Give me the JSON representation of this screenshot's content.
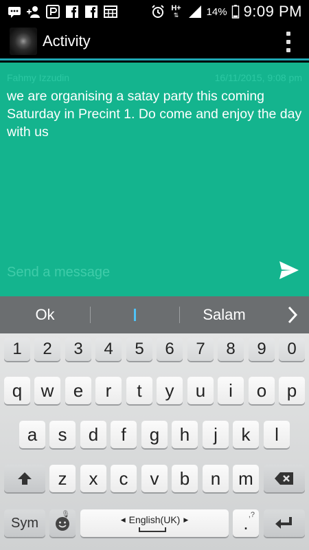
{
  "status_bar": {
    "icons": [
      "chat-icon",
      "add-contact-icon",
      "messenger-icon",
      "facebook-icon",
      "facebook-icon",
      "calendar-icon",
      "alarm-icon",
      "hplus-signal-icon",
      "signal-icon",
      "battery-icon"
    ],
    "network_label": "H+",
    "battery_percent": "14%",
    "time": "9:09 PM"
  },
  "app_bar": {
    "title": "Activity"
  },
  "message": {
    "sender": "Fahmy Izzudin",
    "timestamp": "16/11/2015, 9:08 pm",
    "text": "we are organising a satay party this coming Saturday in Precint 1. Do come and enjoy the day with us"
  },
  "compose": {
    "placeholder": "Send a message",
    "value": ""
  },
  "suggestions": [
    "Ok",
    "",
    "Salam"
  ],
  "keyboard": {
    "number_row": [
      "1",
      "2",
      "3",
      "4",
      "5",
      "6",
      "7",
      "8",
      "9",
      "0"
    ],
    "row1": [
      "q",
      "w",
      "e",
      "r",
      "t",
      "y",
      "u",
      "i",
      "o",
      "p"
    ],
    "row2": [
      "a",
      "s",
      "d",
      "f",
      "g",
      "h",
      "j",
      "k",
      "l"
    ],
    "row3": [
      "z",
      "x",
      "c",
      "v",
      "b",
      "n",
      "m"
    ],
    "sym_label": "Sym",
    "language_label": "English(UK)",
    "period_label": ".",
    "period_hint": ",?",
    "colors": {
      "accent": "#14b48e",
      "key_face": "#f7f7f7",
      "suggestion_bar": "#6b6e70"
    }
  },
  "colors": {
    "chat_background": "#14b48e",
    "app_bar_divider": "#1fa8b4"
  }
}
